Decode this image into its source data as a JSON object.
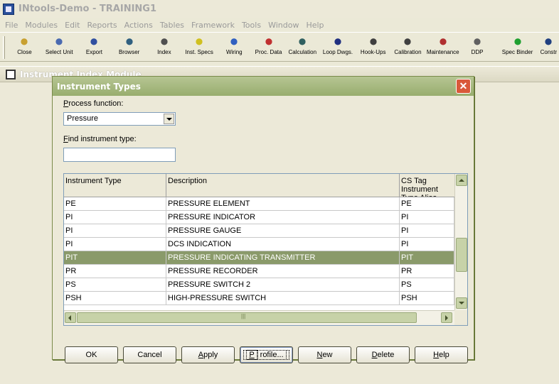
{
  "app": {
    "title": "INtools-Demo - TRAINING1"
  },
  "menu": [
    "File",
    "Modules",
    "Edit",
    "Reports",
    "Actions",
    "Tables",
    "Framework",
    "Tools",
    "Window",
    "Help"
  ],
  "toolbar": [
    {
      "label": "Close",
      "icon": "folder-close-icon"
    },
    {
      "label": "Select Unit",
      "icon": "select-unit-icon"
    },
    {
      "label": "Export",
      "icon": "export-icon"
    },
    {
      "label": "Browser",
      "icon": "browser-icon"
    },
    {
      "label": "Index",
      "icon": "index-icon"
    },
    {
      "label": "Inst. Specs",
      "icon": "inst-specs-icon"
    },
    {
      "label": "Wiring",
      "icon": "wiring-icon"
    },
    {
      "label": "Proc. Data",
      "icon": "proc-data-icon"
    },
    {
      "label": "Calculation",
      "icon": "calculation-icon"
    },
    {
      "label": "Loop Dwgs.",
      "icon": "loop-dwgs-icon"
    },
    {
      "label": "Hook-Ups",
      "icon": "hook-ups-icon"
    },
    {
      "label": "Calibration",
      "icon": "calibration-icon"
    },
    {
      "label": "Maintenance",
      "icon": "maintenance-icon"
    },
    {
      "label": "DDP",
      "icon": "ddp-icon"
    },
    {
      "label": "Spec Binder",
      "icon": "spec-binder-icon"
    },
    {
      "label": "Constr",
      "icon": "construction-icon"
    }
  ],
  "mdi": {
    "title": "Instrument Index Module"
  },
  "dialog": {
    "title": "Instrument Types",
    "process_function_label": "Process function:",
    "process_function_value": "Pressure",
    "find_label": "Find instrument type:",
    "find_value": "",
    "columns": [
      "Instrument Type",
      "Description",
      "CS Tag Instrument Type Alias"
    ],
    "rows": [
      {
        "type": "PE",
        "description": "PRESSURE ELEMENT",
        "alias": "PE",
        "selected": false
      },
      {
        "type": "PI",
        "description": "PRESSURE INDICATOR",
        "alias": "PI",
        "selected": false
      },
      {
        "type": "PI",
        "description": "PRESSURE GAUGE",
        "alias": "PI",
        "selected": false
      },
      {
        "type": "PI",
        "description": "DCS INDICATION",
        "alias": "PI",
        "selected": false
      },
      {
        "type": "PIT",
        "description": "PRESSURE INDICATING TRANSMITTER",
        "alias": "PIT",
        "selected": true
      },
      {
        "type": "PR",
        "description": "PRESSURE RECORDER",
        "alias": "PR",
        "selected": false
      },
      {
        "type": "PS",
        "description": "PRESSURE SWITCH 2",
        "alias": "PS",
        "selected": false
      },
      {
        "type": "PSH",
        "description": "HIGH-PRESSURE SWITCH",
        "alias": "PSH",
        "selected": false
      }
    ],
    "buttons": {
      "ok": "OK",
      "cancel": "Cancel",
      "apply": "Apply",
      "profile": "Profile...",
      "new": "New",
      "delete": "Delete",
      "help": "Help"
    },
    "colors": {
      "title_bar": "#a4b67f",
      "selection": "#8a9a6a",
      "close": "#d9593a"
    }
  }
}
